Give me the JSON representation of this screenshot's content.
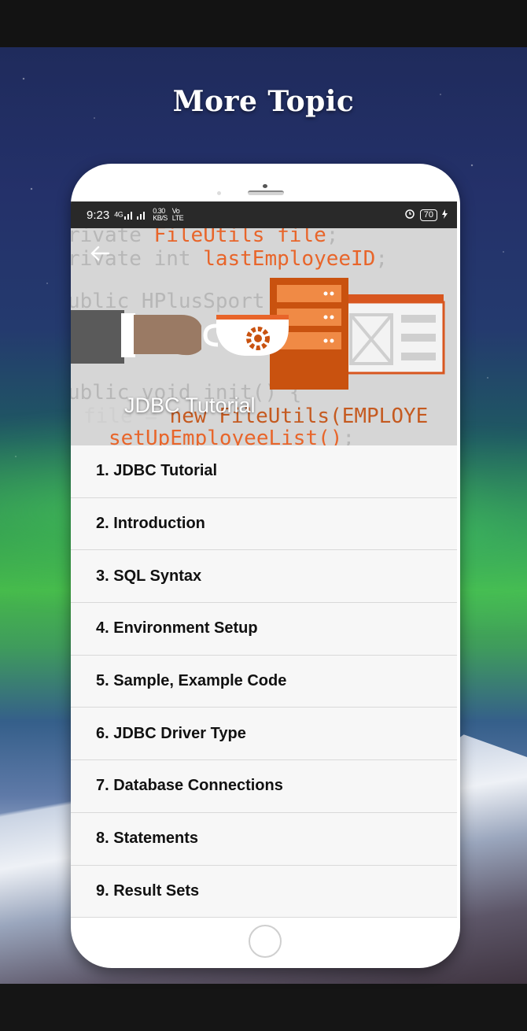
{
  "headline": "More Topic",
  "status_bar": {
    "time": "9:23",
    "signal_text": "4G",
    "speed_value": "0.30",
    "speed_unit": "KB/S",
    "volte": "Vo",
    "lte": "LTE",
    "battery": "70",
    "icons": [
      "signal-icon",
      "alarm-icon",
      "charging-icon"
    ]
  },
  "banner": {
    "title": "JDBC Tutorial",
    "back_icon": "arrow-left-icon",
    "code_lines": [
      {
        "grey": "rivate ",
        "orange": "FileUtils file",
        "rest": ";"
      },
      {
        "grey": "rivate int ",
        "orange": "lastEmployeeID",
        "rest": ";"
      },
      {
        "grey": "ublic HPlusSport",
        "orange": "",
        "rest": ""
      },
      {
        "grey": "ublic void init() {",
        "orange": "",
        "rest": ""
      },
      {
        "grey": "  file = ",
        "orange": "new FileUtils(EMPLOYE",
        "rest": ""
      },
      {
        "grey": "",
        "orange": "setUpEmployeeList()",
        "rest": ";"
      }
    ],
    "colors": {
      "accent": "#e8652a",
      "dark_accent": "#b84a12",
      "background": "#d6d6d6"
    }
  },
  "topics": [
    "1. JDBC Tutorial",
    "2. Introduction",
    "3. SQL Syntax",
    "4. Environment Setup",
    "5. Sample, Example Code",
    "6. JDBC Driver Type",
    "7. Database Connections",
    "8. Statements",
    "9. Result Sets"
  ]
}
